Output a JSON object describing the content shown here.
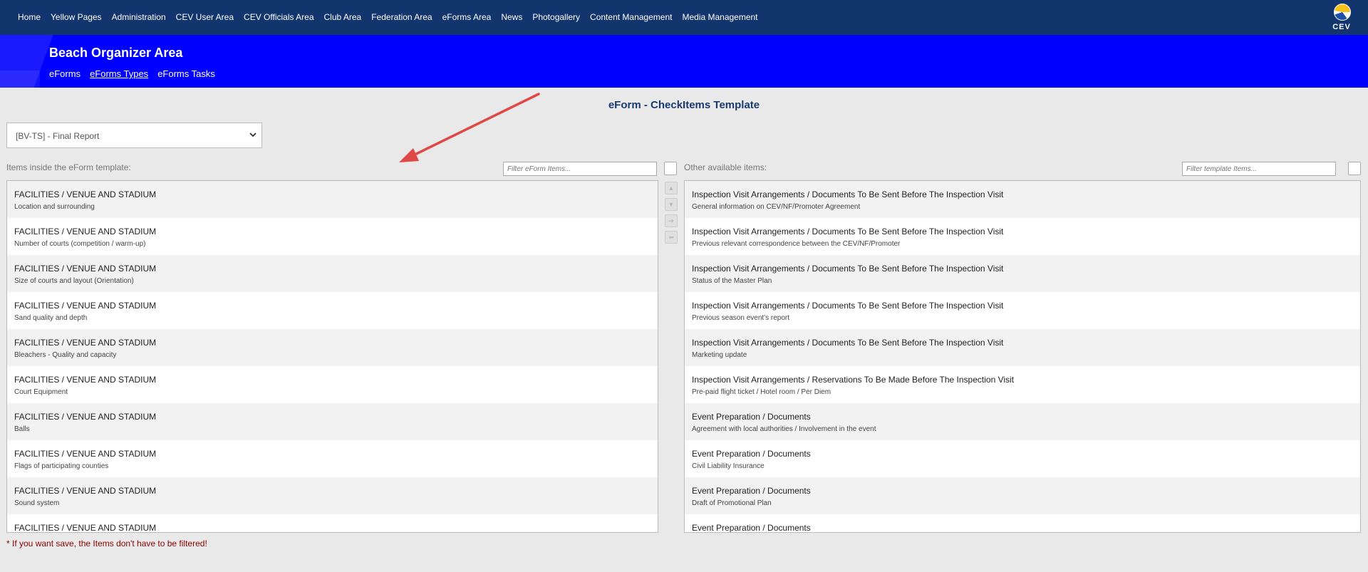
{
  "topnav": {
    "items": [
      "Home",
      "Yellow Pages",
      "Administration",
      "CEV User Area",
      "CEV Officials Area",
      "Club Area",
      "Federation Area",
      "eForms Area",
      "News",
      "Photogallery",
      "Content Management",
      "Media Management"
    ],
    "logo_text": "CEV"
  },
  "banner": {
    "title": "Beach Organizer Area",
    "subnav": [
      "eForms",
      "eForms Types",
      "eForms Tasks"
    ],
    "active_subnav": "eForms Types"
  },
  "page_title": "eForm - CheckItems Template",
  "template_select": {
    "value": "[BV-TS] - Final Report"
  },
  "left_panel": {
    "label": "Items inside the eForm template:",
    "filter_placeholder": "Filter eForm Items...",
    "items": [
      {
        "title": "FACILITIES / VENUE AND STADIUM",
        "sub": "Location and surrounding"
      },
      {
        "title": "FACILITIES / VENUE AND STADIUM",
        "sub": "Number of courts (competition / warm-up)"
      },
      {
        "title": "FACILITIES / VENUE AND STADIUM",
        "sub": "Size of courts and layout (Orientation)"
      },
      {
        "title": "FACILITIES / VENUE AND STADIUM",
        "sub": "Sand quality and depth"
      },
      {
        "title": "FACILITIES / VENUE AND STADIUM",
        "sub": "Bleachers - Quality and capacity"
      },
      {
        "title": "FACILITIES / VENUE AND STADIUM",
        "sub": "Court Equipment"
      },
      {
        "title": "FACILITIES / VENUE AND STADIUM",
        "sub": "Balls"
      },
      {
        "title": "FACILITIES / VENUE AND STADIUM",
        "sub": "Flags of participating counties"
      },
      {
        "title": "FACILITIES / VENUE AND STADIUM",
        "sub": "Sound system"
      },
      {
        "title": "FACILITIES / VENUE AND STADIUM",
        "sub": ""
      }
    ]
  },
  "right_panel": {
    "label": "Other available items:",
    "filter_placeholder": "Filter template Items...",
    "items": [
      {
        "title": "Inspection Visit Arrangements / Documents To Be Sent Before The Inspection Visit",
        "sub": "General information on CEV/NF/Promoter Agreement"
      },
      {
        "title": "Inspection Visit Arrangements / Documents To Be Sent Before The Inspection Visit",
        "sub": "Previous relevant correspondence between the CEV/NF/Promoter"
      },
      {
        "title": "Inspection Visit Arrangements / Documents To Be Sent Before The Inspection Visit",
        "sub": "Status of the Master Plan"
      },
      {
        "title": "Inspection Visit Arrangements / Documents To Be Sent Before The Inspection Visit",
        "sub": "Previous season event's report"
      },
      {
        "title": "Inspection Visit Arrangements / Documents To Be Sent Before The Inspection Visit",
        "sub": "Marketing update"
      },
      {
        "title": "Inspection Visit Arrangements / Reservations To Be Made Before The Inspection Visit",
        "sub": "Pre-paid flight ticket / Hotel room / Per Diem"
      },
      {
        "title": "Event Preparation / Documents",
        "sub": "Agreement with local authorities / Involvement in the event"
      },
      {
        "title": "Event Preparation / Documents",
        "sub": "Civil Liability Insurance"
      },
      {
        "title": "Event Preparation / Documents",
        "sub": "Draft of Promotional Plan"
      },
      {
        "title": "Event Preparation / Documents",
        "sub": ""
      }
    ]
  },
  "icons": {
    "select": "chevron-down-icon",
    "move_up": "arrow-up-icon",
    "move_down": "arrow-down-icon",
    "move_right": "arrow-right-icon",
    "move_left": "arrow-left-icon"
  },
  "colors": {
    "topnav": "#13356e",
    "banner": "#0000fe",
    "title": "#1a3a6e",
    "note": "#8b0000",
    "annotation_arrow": "#e04848"
  },
  "footer_note": "* If you want save, the Items don't have to be filtered!"
}
